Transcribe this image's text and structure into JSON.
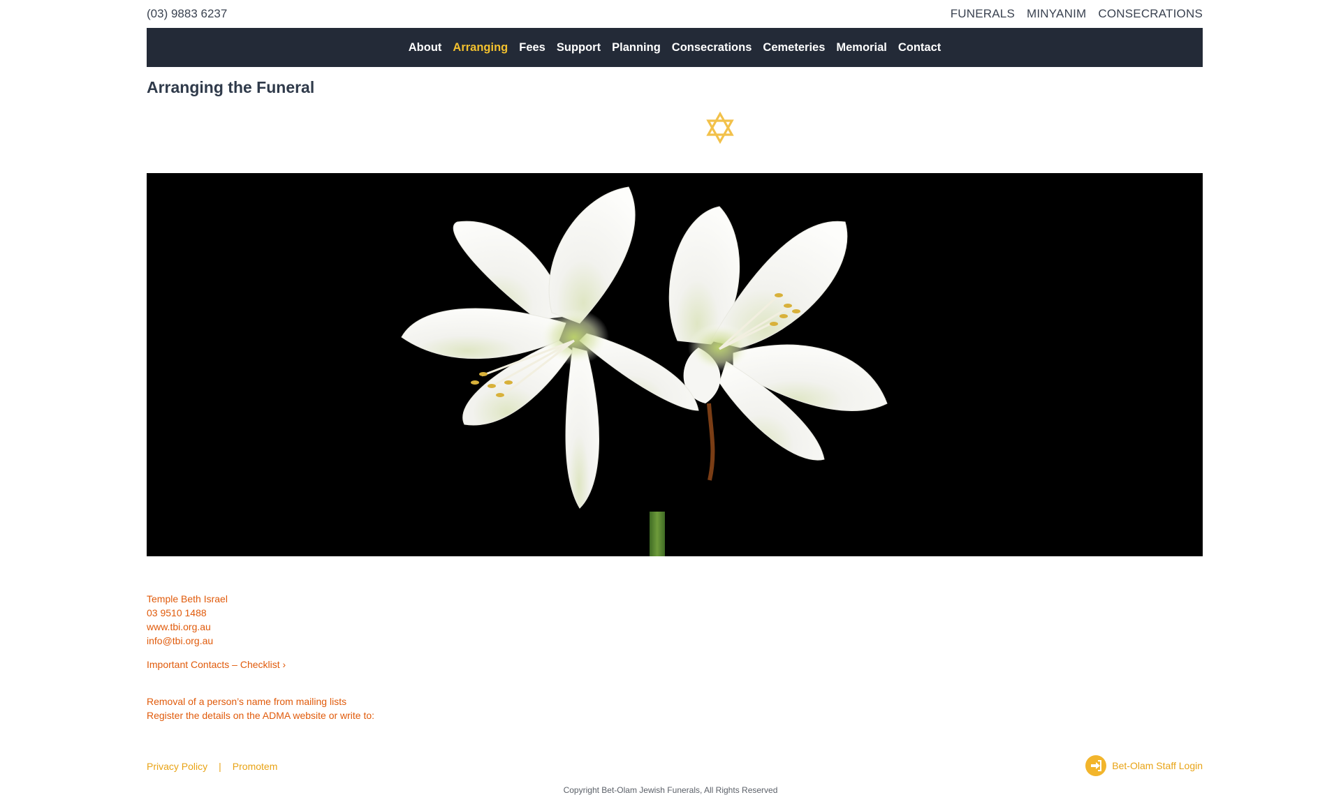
{
  "topbar": {
    "phone": "(03) 9883 6237",
    "links": [
      "FUNERALS",
      "MINYANIM",
      "CONSECRATIONS"
    ]
  },
  "nav": {
    "items": [
      "About",
      "Arranging",
      "Fees",
      "Support",
      "Planning",
      "Consecrations",
      "Cemeteries",
      "Memorial",
      "Contact"
    ],
    "active": "Arranging"
  },
  "page": {
    "title": "Arranging the Funeral",
    "star_icon": "star-of-david-icon",
    "hero_image": "white-lily-flowers"
  },
  "contact": {
    "name": "Temple Beth Israel",
    "phone": "03 9510 1488",
    "website": "www.tbi.org.au",
    "email": "info@tbi.org.au"
  },
  "checklist_link": "Important Contacts – Checklist ›",
  "removal": {
    "heading": "Removal of a person’s name from mailing lists",
    "text": "Register the details on the ADMA website or write to:"
  },
  "footer": {
    "privacy": "Privacy Policy",
    "separator": "|",
    "promotem": "Promotem",
    "staff_login": "Bet-Olam Staff Login",
    "copyright": "Copyright Bet-Olam Jewish Funerals, All Rights Reserved"
  },
  "colors": {
    "nav_bg": "#232a37",
    "accent_gold": "#f3c12e",
    "link_orange": "#e05a0a",
    "footer_gold": "#e8a315"
  }
}
